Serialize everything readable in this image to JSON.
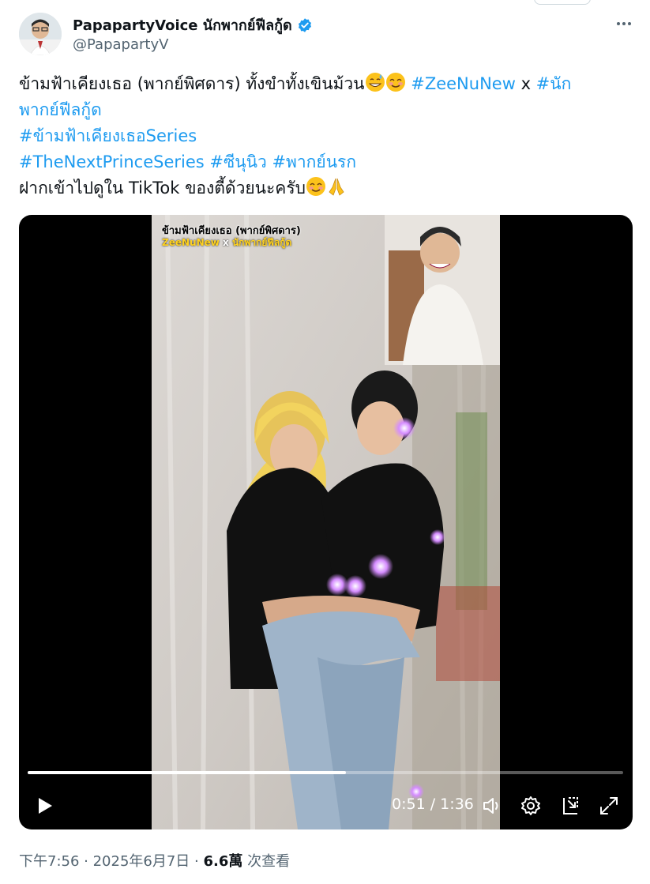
{
  "post": {
    "author": {
      "display_name": "PapapartyVoice นักพากย์ฟีลกู้ด",
      "handle": "@PapapartyV",
      "verified": true
    },
    "text_lines": [
      {
        "plain": "ข้ามฟ้าเคียงเธอ (พากย์พิศดาร) ทั้งขำทั้งเขินม้วน",
        "tag1": "#ZeeNuNew",
        "sep": " x ",
        "tag2": "#นัก"
      },
      {
        "tag": "พากย์ฟีลกู้ด"
      },
      {
        "tag": "#ข้ามฟ้าเคียงเธอSeries"
      },
      {
        "tag1": "#TheNextPrinceSeries",
        "tag2": "#ซีนุนิว",
        "tag3": "#พากย์นรก"
      },
      {
        "plain": "ฝากเข้าไปดูใน TikTok ของตี้ด้วยนะครับ"
      }
    ],
    "emoji_names": [
      "grinning-sweat-emoji",
      "smiling-blush-emoji",
      "smiling-blush-emoji",
      "folded-hands-emoji"
    ],
    "video": {
      "overlay_title": "ข้ามฟ้าเคียงเธอ (พากย์พิศดาร)",
      "overlay_subtitle_left": "ZeeNuNew",
      "overlay_subtitle_sep": " x ",
      "overlay_subtitle_right": "นักพากย์ฟีลกู้ด",
      "time_display": "0:51 / 1:36",
      "progress_fraction": 0.534,
      "controls": [
        "play-icon",
        "volume-icon",
        "settings-icon",
        "dock-icon",
        "fullscreen-icon"
      ]
    },
    "footer": {
      "timestamp": "下午7:56 · 2025年6月7日",
      "dot": " · ",
      "views": "6.6萬",
      "views_label": " 次查看"
    },
    "colors": {
      "link": "#1d9bf0",
      "verified": "#1d9bf0",
      "muted": "#536471"
    }
  }
}
